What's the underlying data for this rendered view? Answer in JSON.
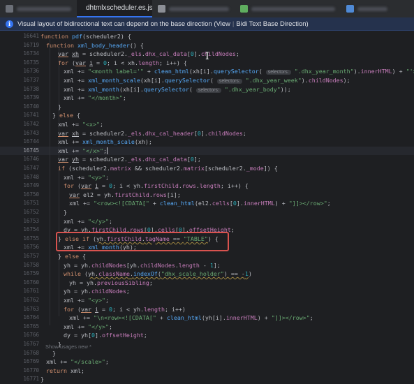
{
  "tabs": [
    {
      "label": "",
      "active": false,
      "icon_color": "#6b6f77"
    },
    {
      "label": "dhtmlxscheduler.es.js",
      "active": true,
      "icon_color": "#d3b52a"
    },
    {
      "label": "",
      "active": false,
      "icon_color": "#8c8f96"
    },
    {
      "label": "",
      "active": false,
      "icon_color": "#5fae5f"
    },
    {
      "label": "",
      "active": false,
      "icon_color": "#4f8ad6"
    }
  ],
  "banner": {
    "info_glyph": "i",
    "message": "Visual layout of bidirectional text can depend on the base direction (View",
    "separator": "|",
    "setting": "Bidi Text Base Direction)"
  },
  "code_lines": [
    {
      "num": "16641",
      "html": "<span class='kw'>function</span> <span class='fn'>pdf</span>(scheduler2) {"
    },
    {
      "num": "16719",
      "html": "  <span class='kw'>function</span> <span class='fn'>xml_body_header</span>() {"
    },
    {
      "num": "16734",
      "html": "    <span class='rl'>var</span> <span class='ul'>xh</span> = scheduler2.<span class='prop'>_els</span>.<span class='prop'>dhx_cal_data</span>[<span class='num'>0</span>].<span class='prop'>childNodes</span>;"
    },
    {
      "num": "16735",
      "html": "    <span class='kw'>for</span> (<span class='rl'>var</span> <span class='ul'>i</span> = <span class='num'>0</span>; i &lt; xh.<span class='prop'>length</span>; i++) {"
    },
    {
      "num": "16736",
      "html": "      xml += <span class='str'>\"&lt;month label='\"</span> + <span class='fn'>clean_html</span>(xh[i].<span class='fn'>querySelector</span>( <span class='hint'>selectors:</span> <span class='str'>\".dhx_year_month\"</span>).<span class='prop'>innerHTML</span>) + <span class='str'>\"'&gt;\"</span>;"
    },
    {
      "num": "16737",
      "html": "      xml += <span class='fn'>xml_month_scale</span>(xh[i].<span class='fn'>querySelector</span>( <span class='hint'>selectors:</span> <span class='str'>\".dhx_year_week\"</span>).<span class='prop'>childNodes</span>);"
    },
    {
      "num": "16738",
      "html": "      xml += <span class='fn'>xml_month</span>(xh[i].<span class='fn'>querySelector</span>( <span class='hint'>selectors:</span> <span class='str'>\".dhx_year_body\"</span>));"
    },
    {
      "num": "16739",
      "html": "      xml += <span class='str'>\"&lt;/month&gt;\"</span>;"
    },
    {
      "num": "16740",
      "html": "    }"
    },
    {
      "num": "16741",
      "html": "  } <span class='kw'>else</span> {"
    },
    {
      "num": "16742",
      "html": "    xml += <span class='str'>\"&lt;x&gt;\"</span>;"
    },
    {
      "num": "16743",
      "html": "    <span class='rl'>var</span> <span class='ul'>xh</span> = scheduler2.<span class='prop'>_els</span>.<span class='prop'>dhx_cal_header</span>[<span class='num'>0</span>].<span class='prop'>childNodes</span>;"
    },
    {
      "num": "16744",
      "html": "    xml += <span class='fn'>xml_month_scale</span>(xh);"
    },
    {
      "num": "16745",
      "html": "    xml += <span class='str'>\"&lt;/x&gt;\"</span>;<span class='caret'></span>",
      "current": true
    },
    {
      "num": "16746",
      "html": "    <span class='rl'>var</span> <span class='ul'>yh</span> = scheduler2.<span class='prop'>_els</span>.<span class='prop'>dhx_cal_data</span>[<span class='num'>0</span>];"
    },
    {
      "num": "16747",
      "html": "    <span class='kw'>if</span> (scheduler2.<span class='prop'>matrix</span> &amp;&amp; scheduler2.<span class='prop'>matrix</span>[scheduler2.<span class='prop'>_mode</span>]) {"
    },
    {
      "num": "16748",
      "html": "      xml += <span class='str'>\"&lt;y&gt;\"</span>;"
    },
    {
      "num": "16749",
      "html": "      <span class='kw'>for</span> (<span class='rl'>var</span> <span class='ul'>i</span> = <span class='num'>0</span>; i &lt; yh.<span class='prop'>firstChild</span>.<span class='prop'>rows</span>.<span class='prop'>length</span>; i++) {"
    },
    {
      "num": "16750",
      "html": "        <span class='rl'>var</span> el2 = yh.<span class='prop'>firstChild</span>.<span class='prop'>rows</span>[i];"
    },
    {
      "num": "16751",
      "html": "        xml += <span class='str'>\"&lt;row&gt;&lt;![CDATA[\"</span> + <span class='fn'>clean_html</span>(el2.<span class='prop'>cells</span>[<span class='num'>0</span>].<span class='prop'>innerHTML</span>) + <span class='str'>\"]]&gt;&lt;/row&gt;\"</span>;"
    },
    {
      "num": "16752",
      "html": "      }"
    },
    {
      "num": "16753",
      "html": "      xml += <span class='str'>\"&lt;/y&gt;\"</span>;"
    },
    {
      "num": "16754",
      "html": "      dy = yh.<span class='prop'>firstChild</span>.<span class='prop'>rows</span>[<span class='num'>0</span>].<span class='prop'>cells</span>[<span class='num'>0</span>].<span class='prop'>offsetHeight</span>;"
    },
    {
      "num": "16755",
      "html": "    } <span class='kw'>else if</span> (<span class='wavy'>yh.<span class='prop'>firstChild</span>.<span class='prop'>tagName</span> == <span class='str'>\"TABLE\"</span></span>) {"
    },
    {
      "num": "16756",
      "html": "      xml += <span class='fn'>xml_month</span>(yh);"
    },
    {
      "num": "16757",
      "html": "    } <span class='kw'>else</span> {"
    },
    {
      "num": "16758",
      "html": "      yh = yh.<span class='prop'>childNodes</span>[yh.<span class='prop'>childNodes</span>.<span class='prop'>length</span> - <span class='num'>1</span>];"
    },
    {
      "num": "16759",
      "html": "      <span class='kw'>while</span> (<span class='wavy'>yh.<span class='prop'>className</span>.<span class='fn'>indexOf</span>(<span class='str'>\"dhx_scale_holder\"</span>) == -<span class='num'>1</span></span>)"
    },
    {
      "num": "16760",
      "html": "        yh = yh.<span class='prop'>previousSibling</span>;"
    },
    {
      "num": "16761",
      "html": "      yh = yh.<span class='prop'>childNodes</span>;"
    },
    {
      "num": "16762",
      "html": "      xml += <span class='str'>\"&lt;y&gt;\"</span>;"
    },
    {
      "num": "16763",
      "html": "      <span class='kw'>for</span> (<span class='rl'>var</span> <span class='ul'>i</span> = <span class='num'>0</span>; i &lt; yh.<span class='prop'>length</span>; i++)"
    },
    {
      "num": "16764",
      "html": "        xml += <span class='str'>\"\\n&lt;row&gt;&lt;![CDATA[\"</span> + <span class='fn'>clean_html</span>(yh[i].<span class='prop'>innerHTML</span>) + <span class='str'>\"]]&gt;&lt;/row&gt;\"</span>;"
    },
    {
      "num": "16765",
      "html": "      xml += <span class='str'>\"&lt;/y&gt;\"</span>;"
    },
    {
      "num": "16766",
      "html": "      dy = yh[<span class='num'>0</span>].<span class='prop'>offsetHeight</span>;"
    },
    {
      "num": "16767",
      "html": "    }"
    },
    {
      "num": "16768",
      "html": "  }"
    },
    {
      "num": "16769",
      "html": "  xml += <span class='str'>\"&lt;/scale&gt;\"</span>;"
    },
    {
      "num": "16770",
      "html": "  <span class='kw'>return</span> xml;"
    },
    {
      "num": "16771",
      "html": "}"
    }
  ],
  "footer": {
    "text": "Show usages   new *"
  },
  "colors": {
    "background": "#1e1f22",
    "keyword": "#cf8e6d",
    "function": "#56a8f5",
    "string": "#6aab73",
    "number": "#2aacb8",
    "property": "#c77dbb",
    "highlight_box": "#d9534f",
    "accent": "#3574f0"
  }
}
